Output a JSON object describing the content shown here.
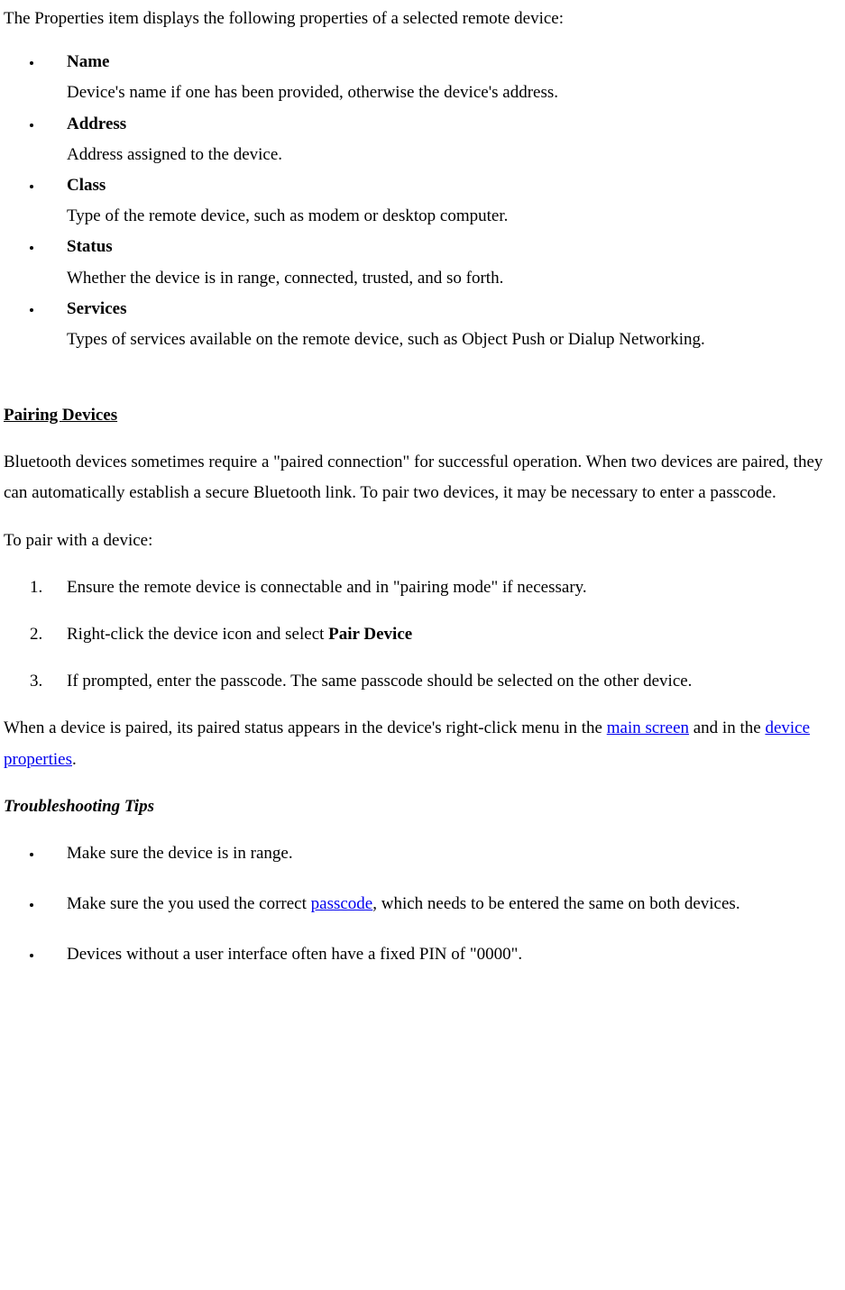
{
  "intro": "The Properties item displays the following properties of a selected remote device:",
  "props": [
    {
      "term": "Name",
      "desc": "Device's name if one has been provided, otherwise the device's address."
    },
    {
      "term": "Address",
      "desc": "Address assigned to the device."
    },
    {
      "term": "Class",
      "desc": "Type of the remote device, such as modem or desktop computer."
    },
    {
      "term": "Status",
      "desc": "Whether the device is in range, connected, trusted, and so forth."
    },
    {
      "term": "Services",
      "desc": "Types of services available on the remote device, such as Object Push or Dialup Networking."
    }
  ],
  "section_pairing_title": "Pairing Devices",
  "pairing_desc": "Bluetooth devices sometimes require a \"paired connection\" for successful operation. When two devices are paired, they can automatically establish a secure Bluetooth link. To pair two devices, it may be necessary to enter a passcode.",
  "pairing_to": "To pair with a device:",
  "steps": {
    "s1": "Ensure the remote device is connectable and in \"pairing mode\" if necessary.",
    "s2a": "Right-click the device icon and select ",
    "s2b": "Pair Device",
    "s3": "If prompted, enter the passcode. The same passcode should be selected on the other device."
  },
  "paired_status": {
    "a": "When a device is paired, its paired status appears in the device's right-click menu in the ",
    "link1": "main screen",
    "b": " and in the ",
    "link2": "device properties",
    "c": "."
  },
  "troubleshooting_title": "Troubleshooting Tips",
  "tips": {
    "t1": "Make sure the device is in range.",
    "t2a": "Make sure the you used the correct ",
    "t2link": "passcode",
    "t2b": ", which needs to be entered the same on both devices.",
    "t3": "Devices without a user interface often have a fixed PIN of \"0000\"."
  }
}
